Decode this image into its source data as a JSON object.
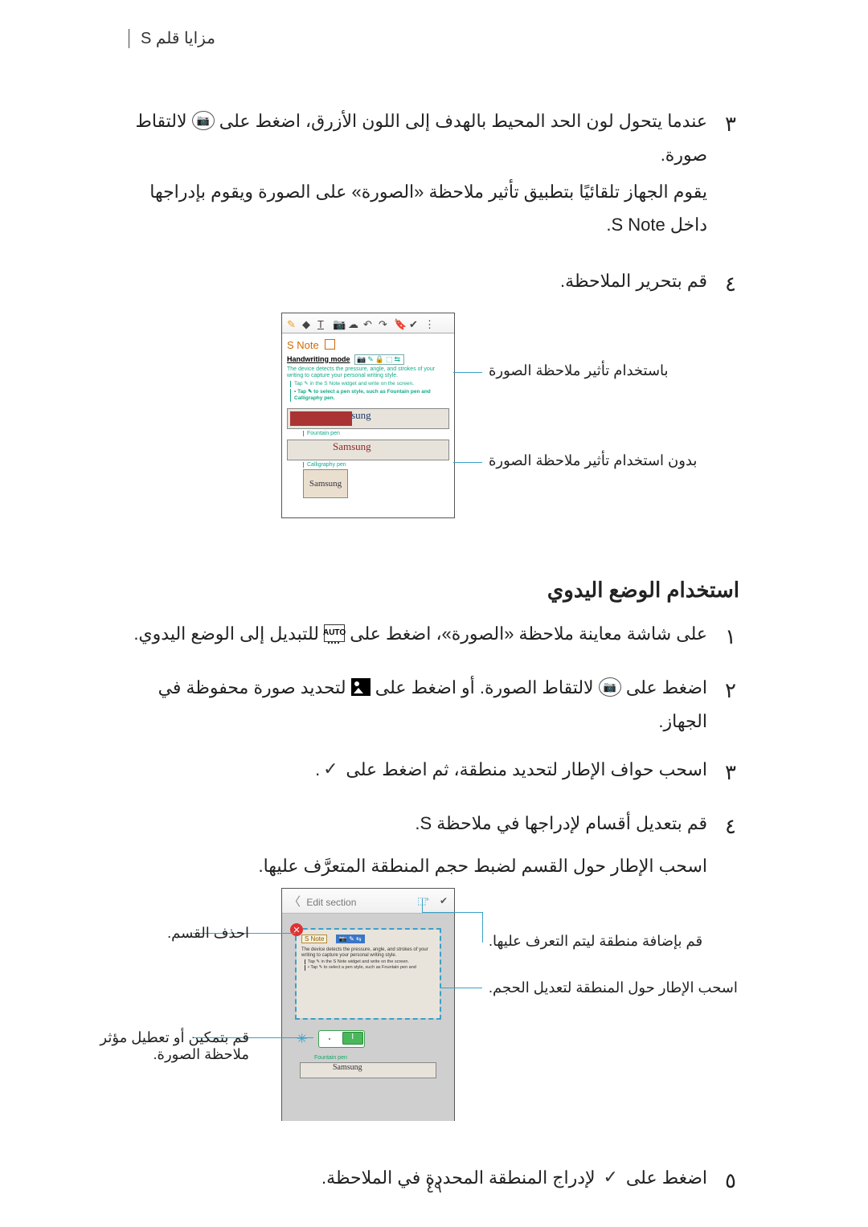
{
  "header": "مزايا قلم S",
  "step3_num": "٣",
  "step3_a": "عندما يتحول لون الحد المحيط بالهدف إلى اللون الأزرق، اضغط على",
  "step3_b": "لالتقاط صورة.",
  "step3_para": "يقوم الجهاز تلقائيًا بتطبيق تأثير ملاحظة «الصورة» على الصورة ويقوم بإدراجها داخل S Note.",
  "step4_num": "٤",
  "step4": "قم بتحرير الملاحظة.",
  "fig1": {
    "snote_title": "S Note",
    "hw_label": "Handwriting mode",
    "hw_desc": "The device detects the pressure, angle, and strokes of your writing to capture your personal writing style.",
    "hw_b1": "Tap ✎ in the S Note widget and write on the screen.",
    "hw_b2": "• Tap ✎ to select a pen style, such as Fountain pen and Calligraphy pen.",
    "cap_fp": "Fountain pen",
    "cap_cp": "Calligraphy pen",
    "callout_with": "باستخدام تأثير ملاحظة الصورة",
    "callout_without": "بدون استخدام تأثير ملاحظة الصورة"
  },
  "section_title": "استخدام الوضع اليدوي",
  "m1_num": "١",
  "m1_a": "على شاشة معاينة ملاحظة «الصورة»، اضغط على",
  "m1_auto": "AUTO",
  "m1_b": "للتبديل إلى الوضع اليدوي.",
  "m2_num": "٢",
  "m2_a": "اضغط على",
  "m2_b": "لالتقاط الصورة. أو اضغط على",
  "m2_c": "لتحديد صورة محفوظة في الجهاز.",
  "m3_num": "٣",
  "m3_a": "اسحب حواف الإطار لتحديد منطقة، ثم اضغط على",
  "m3_b": ".",
  "m4_num": "٤",
  "m4": "قم بتعديل أقسام لإدراجها في ملاحظة S.",
  "m4_para": "اسحب الإطار حول القسم لضبط حجم المنطقة المتعرَّف عليها.",
  "fig2": {
    "bar_title": "Edit section",
    "chip1": "S Note",
    "mini1": "The device detects the pressure, angle, and strokes of your writing to capture your personal writing style.",
    "mini2a": "Tap ✎ in the S Note widget and write on the screen.",
    "mini2b": "• Tap ✎ to select a pen style, such as Fountain pen and",
    "lab_fp": "Fountain pen",
    "callout_add": "قم بإضافة منطقة ليتم التعرف عليها.",
    "callout_del": "احذف القسم.",
    "callout_resize": "اسحب الإطار حول المنطقة لتعديل الحجم.",
    "callout_toggle": "قم بتمكين أو تعطيل مؤثر ملاحظة الصورة."
  },
  "m5_num": "٥",
  "m5_a": "اضغط على",
  "m5_b": "لإدراج المنطقة المحددة في الملاحظة.",
  "page_number": "٤٩"
}
